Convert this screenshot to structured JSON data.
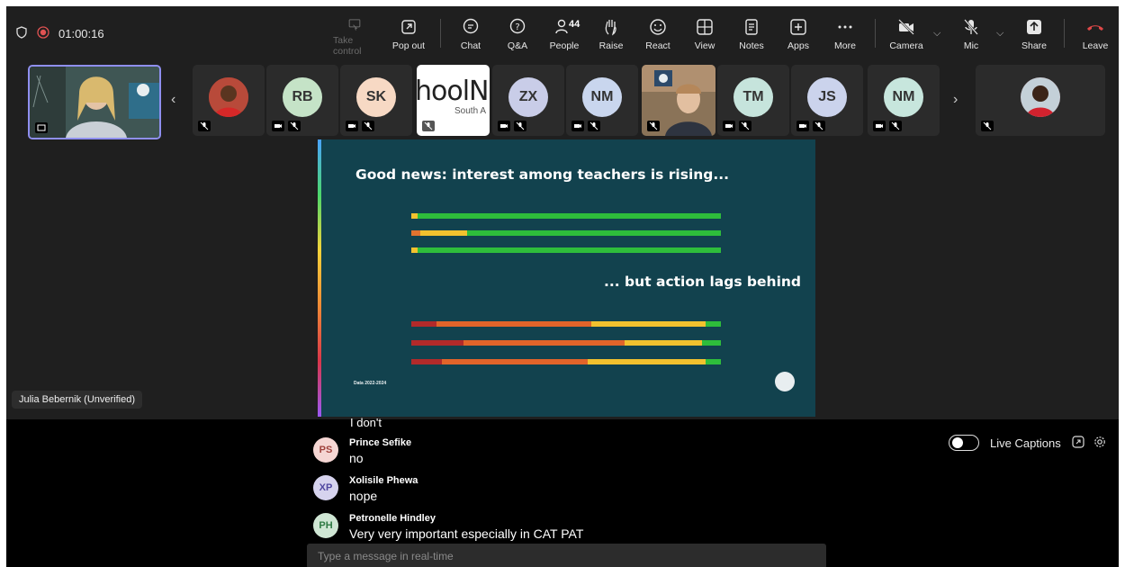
{
  "toolbar": {
    "timer": "01:00:16",
    "buttons": [
      {
        "label": "Take control",
        "icon": "take-control-icon"
      },
      {
        "label": "Pop out",
        "icon": "pop-out-icon"
      },
      {
        "label": "Chat",
        "icon": "chat-icon"
      },
      {
        "label": "Q&A",
        "icon": "qa-icon"
      },
      {
        "label": "People",
        "icon": "people-icon",
        "count": "44"
      },
      {
        "label": "Raise",
        "icon": "raise-hand-icon"
      },
      {
        "label": "React",
        "icon": "react-icon"
      },
      {
        "label": "View",
        "icon": "view-icon"
      },
      {
        "label": "Notes",
        "icon": "notes-icon"
      },
      {
        "label": "Apps",
        "icon": "apps-icon"
      },
      {
        "label": "More",
        "icon": "more-icon"
      },
      {
        "label": "Camera",
        "icon": "camera-off-icon"
      },
      {
        "label": "Mic",
        "icon": "mic-off-icon"
      },
      {
        "label": "Share",
        "icon": "share-icon"
      },
      {
        "label": "Leave",
        "icon": "leave-icon"
      }
    ]
  },
  "participants": [
    {
      "initials": "RB",
      "color": "#c5e3c7"
    },
    {
      "initials": "SK",
      "color": "#f7d9c4"
    },
    {
      "initials": "ZX",
      "color": "#c9cde8"
    },
    {
      "initials": "NM",
      "color": "#c9d6ee"
    },
    {
      "initials": "TM",
      "color": "#c6e4dc"
    },
    {
      "initials": "JS",
      "color": "#cbd3ec"
    },
    {
      "initials": "NM",
      "color": "#c7e6dd"
    }
  ],
  "thumbnail_logo_text": "hoolNe",
  "thumbnail_logo_sub": "South A",
  "slide": {
    "title1": "Good news: interest among teachers is rising...",
    "title2": "... but action lags behind",
    "data_label": "Data 2022-2024"
  },
  "presenter_name": "Julia Bebernik (Unverified)",
  "captions": {
    "live_label": "Live Captions",
    "partial_text": "I don't",
    "items": [
      {
        "initials": "PS",
        "name": "Prince Sefike",
        "text": "no",
        "color": "#f5d6d3"
      },
      {
        "initials": "XP",
        "name": "Xolisile Phewa",
        "text": "nope",
        "color": "#d6d3ee"
      },
      {
        "initials": "PH",
        "name": "Petronelle Hindley",
        "text": "Very very important especially in CAT PAT",
        "color": "#cfe6d4"
      }
    ],
    "input_placeholder": "Type a message in real-time"
  }
}
